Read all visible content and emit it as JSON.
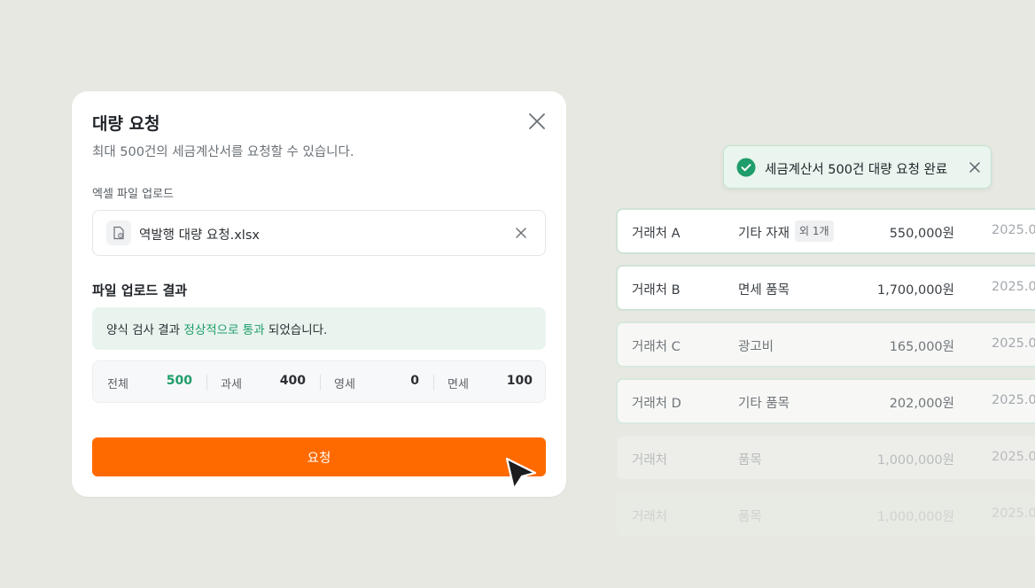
{
  "modal": {
    "title": "대량 요청",
    "subtitle": "최대 500건의 세금계산서를 요청할 수 있습니다.",
    "upload_label": "엑셀 파일 업로드",
    "file_name": "역발행 대량 요청.xlsx",
    "result_title": "파일 업로드 결과",
    "result_banner": {
      "prefix": "양식 검사 결과 ",
      "highlight": "정상적으로 통과",
      "suffix": " 되었습니다."
    },
    "stats": [
      {
        "label": "전체",
        "value": "500"
      },
      {
        "label": "과세",
        "value": "400"
      },
      {
        "label": "영세",
        "value": "0"
      },
      {
        "label": "면세",
        "value": "100"
      }
    ],
    "submit_label": "요청"
  },
  "toast": {
    "message": "세금계산서 500건 대량 요청 완료"
  },
  "rows": [
    {
      "vendor": "거래처 A",
      "item": "기타 자재",
      "extra": "외 1개",
      "amount": "550,000원",
      "date": "2025.0"
    },
    {
      "vendor": "거래처 B",
      "item": "면세 품목",
      "amount": "1,700,000원",
      "date": "2025.0"
    },
    {
      "vendor": "거래처 C",
      "item": "광고비",
      "amount": "165,000원",
      "date": "2025.0"
    },
    {
      "vendor": "거래처 D",
      "item": "기타 품목",
      "amount": "202,000원",
      "date": "2025.0"
    },
    {
      "vendor": "거래처",
      "item": "품목",
      "amount": "1,000,000원",
      "date": "2025.0"
    },
    {
      "vendor": "거래처",
      "item": "품목",
      "amount": "1,000,000원",
      "date": "2025.0"
    }
  ],
  "colors": {
    "background": "#e6e8e1",
    "accent": "#ff6a00",
    "success": "#1f9d6a",
    "toast_bg": "#e9f5ee"
  },
  "icons": {
    "close": "close-icon",
    "file": "excel-file-icon",
    "check": "check-circle-icon",
    "cursor": "mouse-pointer-icon"
  }
}
